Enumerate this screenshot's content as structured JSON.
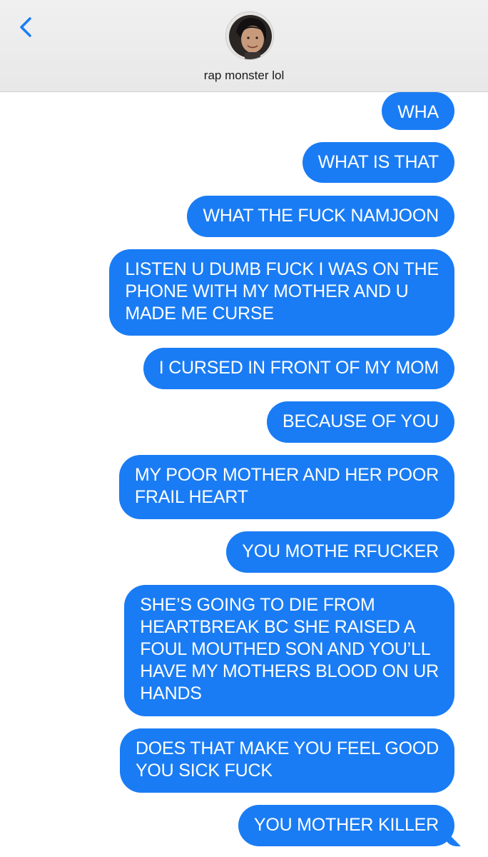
{
  "header": {
    "back_icon": "chevron-left-icon",
    "contact_name": "rap monster lol",
    "accent_color": "#1a7cf4"
  },
  "messages": [
    {
      "text": "WHA"
    },
    {
      "text": "WHAT IS THAT"
    },
    {
      "text": "WHAT THE FUCK NAMJOON"
    },
    {
      "text": "LISTEN U DUMB FUCK I WAS ON THE\nPHONE WITH MY MOTHER AND U\nMADE ME CURSE"
    },
    {
      "text": "I CURSED IN FRONT OF MY MOM"
    },
    {
      "text": "BECAUSE OF YOU"
    },
    {
      "text": "MY POOR MOTHER AND HER POOR\nFRAIL HEART"
    },
    {
      "text": "YOU MOTHE RFUCKER"
    },
    {
      "text": "SHE’S GOING TO DIE FROM\nHEARTBREAK BC SHE RAISED A\nFOUL MOUTHED SON AND YOU’LL\nHAVE MY MOTHERS BLOOD ON UR\nHANDS"
    },
    {
      "text": "DOES THAT MAKE YOU FEEL GOOD\nYOU SICK FUCK"
    },
    {
      "text": "YOU MOTHER KILLER"
    }
  ]
}
